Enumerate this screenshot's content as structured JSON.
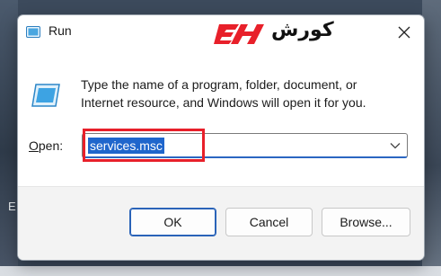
{
  "window": {
    "title": "Run",
    "close_icon": "close-icon",
    "app_icon": "run-app-icon"
  },
  "watermark": {
    "brand_text": "کورش",
    "mark": "EH",
    "brand_color": "#e8202a"
  },
  "content": {
    "description_line1": "Type the name of a program, folder, document, or",
    "description_line2": "Internet resource, and Windows will open it for you.",
    "open_label_prefix": "O",
    "open_label_rest": "pen:",
    "open_value": "services.msc",
    "dropdown_icon": "chevron-down-icon"
  },
  "buttons": {
    "ok": "OK",
    "cancel": "Cancel",
    "browse": "Browse..."
  },
  "colors": {
    "accent": "#1f66cc",
    "highlight_box": "#e8202a"
  }
}
